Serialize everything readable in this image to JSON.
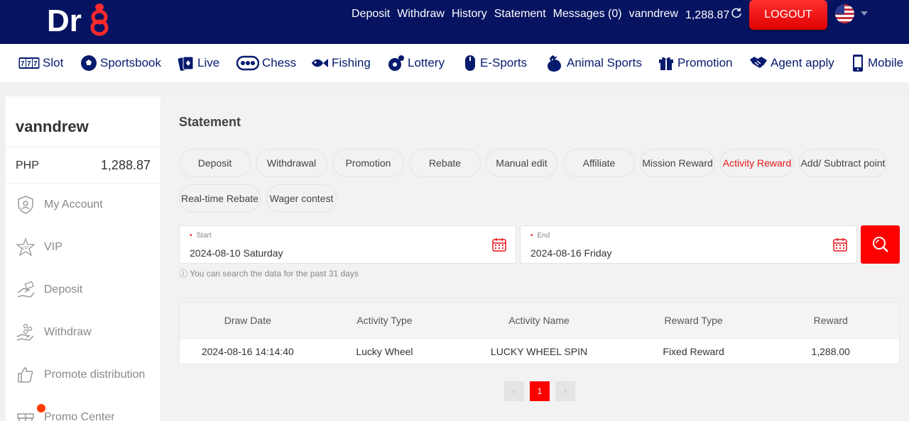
{
  "header": {
    "logo_text": "Dr8",
    "nav": [
      "Deposit",
      "Withdraw",
      "History",
      "Statement",
      "Messages (0)"
    ],
    "username": "vanndrew",
    "balance": "1,288.87",
    "logout_label": "LOGOUT",
    "language_flag": "us-flag-icon",
    "colors": {
      "header_bg": "#051361",
      "accent": "#ff0000"
    }
  },
  "categories": [
    {
      "label": "Slot",
      "icon": "slot-777-icon"
    },
    {
      "label": "Sportsbook",
      "icon": "soccer-ball-icon"
    },
    {
      "label": "Live",
      "icon": "live-cards-icon"
    },
    {
      "label": "Chess",
      "icon": "chess-icon"
    },
    {
      "label": "Fishing",
      "icon": "fish-icon"
    },
    {
      "label": "Lottery",
      "icon": "lottery-ball-icon"
    },
    {
      "label": "E-Sports",
      "icon": "mouse-icon"
    },
    {
      "label": "Animal Sports",
      "icon": "rooster-icon"
    },
    {
      "label": "Promotion",
      "icon": "gift-icon"
    },
    {
      "label": "Agent apply",
      "icon": "handshake-icon"
    },
    {
      "label": "Mobile",
      "icon": "mobile-icon"
    }
  ],
  "sidebar": {
    "username": "vanndrew",
    "currency": "PHP",
    "balance": "1,288.87",
    "items": [
      {
        "label": "My Account",
        "icon": "user-shield-icon"
      },
      {
        "label": "VIP",
        "icon": "vip-star-icon"
      },
      {
        "label": "Deposit",
        "icon": "deposit-hand-icon"
      },
      {
        "label": "Withdraw",
        "icon": "withdraw-hand-icon"
      },
      {
        "label": "Promote distribution",
        "icon": "thumbs-up-icon"
      },
      {
        "label": "Promo Center",
        "icon": "gift-icon"
      }
    ]
  },
  "statement": {
    "title": "Statement",
    "tabs": [
      "Deposit",
      "Withdrawal",
      "Promotion",
      "Rebate",
      "Manual edit",
      "Affiliate",
      "Mission Reward",
      "Activity Reward",
      "Add/ Subtract point",
      "Real-time Rebate",
      "Wager contest"
    ],
    "active_tab": "Activity Reward",
    "start": {
      "label": "Start",
      "value": "2024-08-10 Saturday"
    },
    "end": {
      "label": "End",
      "value": "2024-08-16 Friday"
    },
    "hint": "You can search the data for the past 31 days",
    "table": {
      "headers": [
        "Draw Date",
        "Activity Type",
        "Activity Name",
        "Reward Type",
        "Reward"
      ],
      "rows": [
        [
          "2024-08-16 14:14:40",
          "Lucky Wheel",
          "LUCKY WHEEL SPIN",
          "Fixed Reward",
          "1,288.00"
        ]
      ]
    },
    "pagination": {
      "current": "1"
    }
  }
}
